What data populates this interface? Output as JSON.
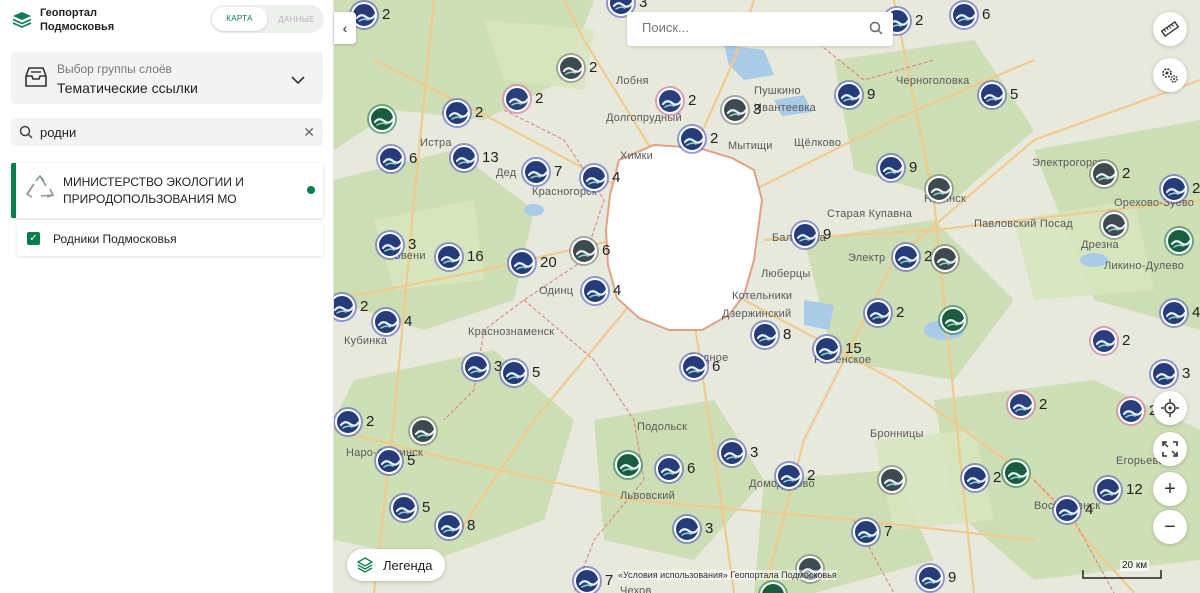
{
  "app": {
    "name_line1": "Геопортал",
    "name_line2": "Подмосковья",
    "tab_map": "КАРТА",
    "tab_data": "ДАННЫЕ"
  },
  "sidebar": {
    "group_caption": "Выбор группы слоёв",
    "group_value": "Тематические ссылки",
    "search_value": "родни",
    "result_title": "МИНИСТЕРСТВО ЭКОЛОГИИ И ПРИРОДОПОЛЬЗОВАНИЯ МО",
    "layer_label": "Родники Подмосковья",
    "layer_checked": true
  },
  "map": {
    "search_placeholder": "Поиск...",
    "legend_label": "Легенда",
    "copyright": "«Условия использования» Геопортала Подмосковья",
    "scale_label": "20 км",
    "labels": [
      {
        "text": "Лобня"
      },
      {
        "text": "Пушкино"
      },
      {
        "text": "Ивантеевка"
      },
      {
        "text": "Черноголовка"
      },
      {
        "text": "Долгопрудный"
      },
      {
        "text": "Истра"
      },
      {
        "text": "Химки"
      },
      {
        "text": "Мытищи"
      },
      {
        "text": "Щёлково"
      },
      {
        "text": "Электрогорск"
      },
      {
        "text": "Дед"
      },
      {
        "text": "Красногорск"
      },
      {
        "text": "Ногинск"
      },
      {
        "text": "Старая Купавна"
      },
      {
        "text": "Павловский Посад"
      },
      {
        "text": "Орехово-Зуево"
      },
      {
        "text": "Балашиха"
      },
      {
        "text": "Дрезна"
      },
      {
        "text": "Звени"
      },
      {
        "text": "Электр"
      },
      {
        "text": "Люберцы"
      },
      {
        "text": "Ликино-Дулево"
      },
      {
        "text": "Одинц"
      },
      {
        "text": "Котельники"
      },
      {
        "text": "Дзержинский"
      },
      {
        "text": "Краснознаменск"
      },
      {
        "text": "Кубинка"
      },
      {
        "text": "Раменское"
      },
      {
        "text": "Видное"
      },
      {
        "text": "Подольск"
      },
      {
        "text": "Бронницы"
      },
      {
        "text": "Наро-Фоминск"
      },
      {
        "text": "Львовский"
      },
      {
        "text": "Домодедово"
      },
      {
        "text": "Егорьевск"
      },
      {
        "text": "Воскресенск"
      },
      {
        "text": "Чехов"
      }
    ],
    "markers": [
      {
        "count": "2",
        "style": "blue"
      },
      {
        "count": "3",
        "style": "blue"
      },
      {
        "count": "2",
        "style": "blue"
      },
      {
        "count": "6",
        "style": "blue"
      },
      {
        "count": "2",
        "style": "grey"
      },
      {
        "count": "2",
        "style": "pink"
      },
      {
        "count": "3",
        "style": "grey"
      },
      {
        "count": "9",
        "style": "blue"
      },
      {
        "count": "5",
        "style": "blue"
      },
      {
        "count": "",
        "style": "green"
      },
      {
        "count": "2",
        "style": "blue"
      },
      {
        "count": "2",
        "style": "pink"
      },
      {
        "count": "2",
        "style": "blue"
      },
      {
        "count": "6",
        "style": "blue"
      },
      {
        "count": "13",
        "style": "blue"
      },
      {
        "count": "7",
        "style": "blue"
      },
      {
        "count": "4",
        "style": "blue"
      },
      {
        "count": "9",
        "style": "blue"
      },
      {
        "count": "",
        "style": "grey"
      },
      {
        "count": "2",
        "style": "grey"
      },
      {
        "count": "2",
        "style": "blue"
      },
      {
        "count": "3",
        "style": "blue"
      },
      {
        "count": "16",
        "style": "blue"
      },
      {
        "count": "20",
        "style": "blue"
      },
      {
        "count": "6",
        "style": "grey"
      },
      {
        "count": "9",
        "style": "blue"
      },
      {
        "count": "2",
        "style": "blue"
      },
      {
        "count": "",
        "style": "grey"
      },
      {
        "count": "",
        "style": "grey"
      },
      {
        "count": "",
        "style": "green"
      },
      {
        "count": "4",
        "style": "blue"
      },
      {
        "count": "2",
        "style": "blue"
      },
      {
        "count": "4",
        "style": "blue"
      },
      {
        "count": "2",
        "style": "blue"
      },
      {
        "count": "",
        "style": "green"
      },
      {
        "count": "8",
        "style": "blue"
      },
      {
        "count": "15",
        "style": "blue"
      },
      {
        "count": "2",
        "style": "pink"
      },
      {
        "count": "4",
        "style": "blue"
      },
      {
        "count": "3",
        "style": "blue"
      },
      {
        "count": "5",
        "style": "blue"
      },
      {
        "count": "6",
        "style": "blue"
      },
      {
        "count": "3",
        "style": "blue"
      },
      {
        "count": "2",
        "style": "pink"
      },
      {
        "count": "2",
        "style": "blue"
      },
      {
        "count": "2",
        "style": "pink"
      },
      {
        "count": "",
        "style": "grey"
      },
      {
        "count": "5",
        "style": "blue"
      },
      {
        "count": "",
        "style": "green"
      },
      {
        "count": "6",
        "style": "blue"
      },
      {
        "count": "3",
        "style": "blue"
      },
      {
        "count": "2",
        "style": "blue"
      },
      {
        "count": "",
        "style": "grey"
      },
      {
        "count": "2",
        "style": "blue"
      },
      {
        "count": "",
        "style": "green"
      },
      {
        "count": "12",
        "style": "blue"
      },
      {
        "count": "5",
        "style": "blue"
      },
      {
        "count": "8",
        "style": "blue"
      },
      {
        "count": "3",
        "style": "blue"
      },
      {
        "count": "7",
        "style": "blue"
      },
      {
        "count": "4",
        "style": "blue"
      },
      {
        "count": "7",
        "style": "blue"
      },
      {
        "count": "",
        "style": "grey"
      },
      {
        "count": "",
        "style": "green"
      },
      {
        "count": "9",
        "style": "blue"
      }
    ]
  },
  "colors": {
    "accent": "#0a7d4e",
    "marker_blue": "#253b7a",
    "moscow_fill": "#ffffff"
  }
}
